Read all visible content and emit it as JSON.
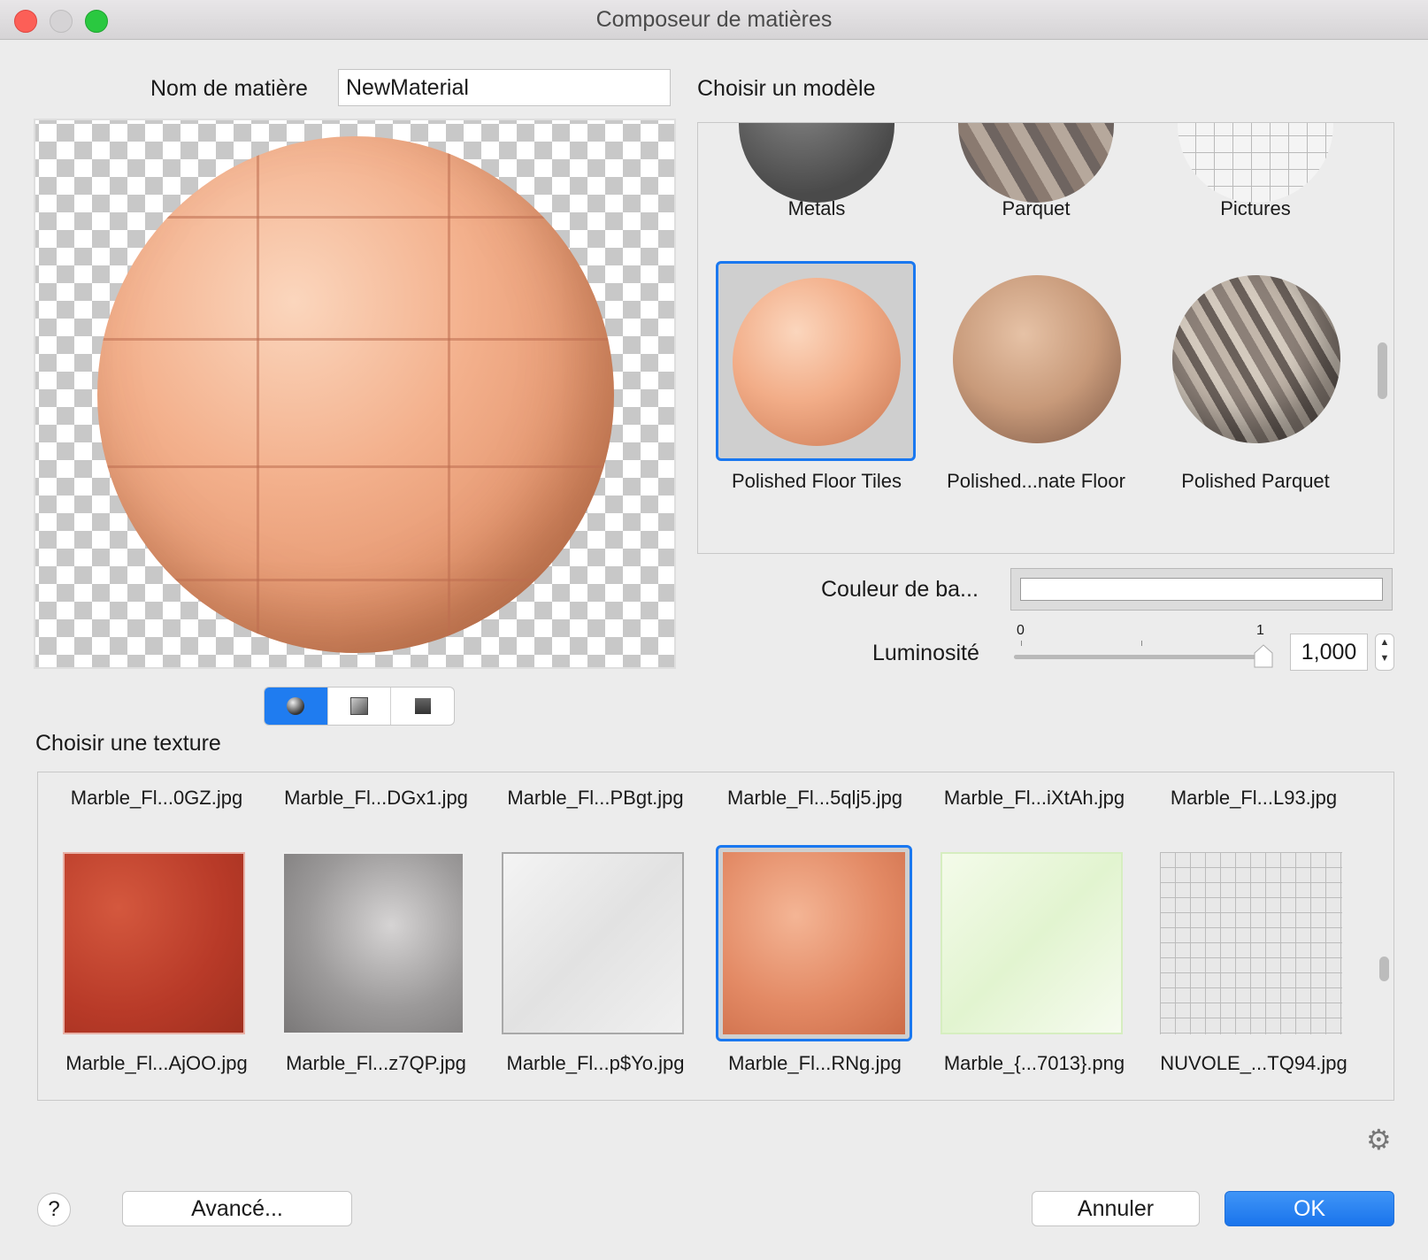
{
  "window": {
    "title": "Composeur de matières"
  },
  "name": {
    "label": "Nom de matière",
    "value": "NewMaterial"
  },
  "model": {
    "label": "Choisir un modèle",
    "top_row": [
      "Metals",
      "Parquet",
      "Pictures"
    ],
    "items": [
      "Polished Floor Tiles",
      "Polished...nate Floor",
      "Polished Parquet"
    ],
    "selected": "Polished Floor Tiles"
  },
  "color": {
    "label": "Couleur de ba...",
    "value": "#ffffff"
  },
  "luminosity": {
    "label": "Luminosité",
    "min_label": "0",
    "max_label": "1",
    "value_text": "1,000",
    "value": 1.0
  },
  "preview_shapes": [
    "sphere-icon",
    "cube-icon",
    "plane-icon"
  ],
  "texture": {
    "label": "Choisir une texture",
    "top_row": [
      "Marble_Fl...0GZ.jpg",
      "Marble_Fl...DGx1.jpg",
      "Marble_Fl...PBgt.jpg",
      "Marble_Fl...5qlj5.jpg",
      "Marble_Fl...iXtAh.jpg",
      "Marble_Fl...L93.jpg"
    ],
    "items": [
      "Marble_Fl...AjOO.jpg",
      "Marble_Fl...z7QP.jpg",
      "Marble_Fl...p$Yo.jpg",
      "Marble_Fl...RNg.jpg",
      "Marble_{...7013}.png",
      "NUVOLE_...TQ94.jpg"
    ],
    "selected": "Marble_Fl...RNg.jpg"
  },
  "buttons": {
    "help": "?",
    "advanced": "Avancé...",
    "cancel": "Annuler",
    "ok": "OK"
  },
  "colors": {
    "accent": "#1a78f0"
  }
}
